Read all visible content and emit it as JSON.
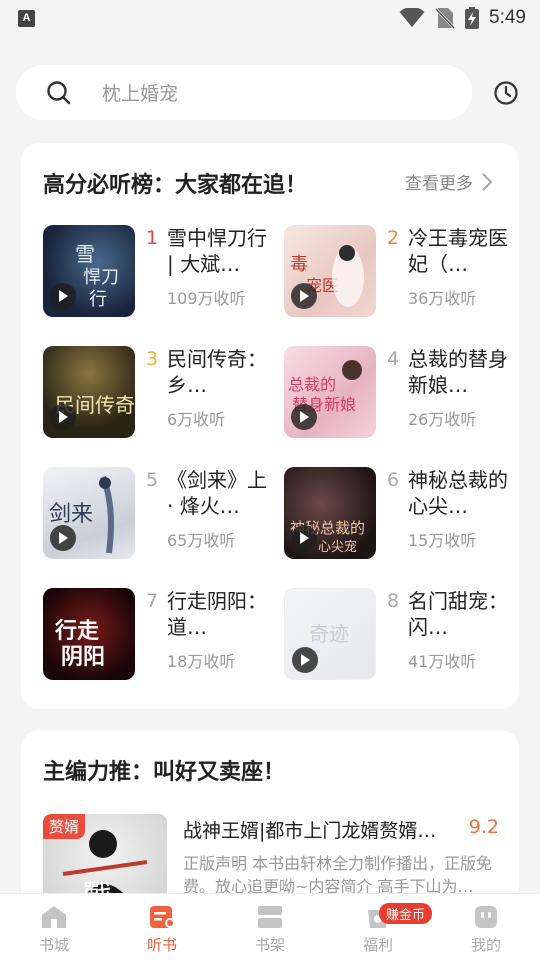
{
  "status_bar": {
    "time": "5:49",
    "left_icon_letter": "A"
  },
  "search": {
    "placeholder": "枕上婚宠"
  },
  "rank_section": {
    "title": "高分必听榜：大家都在追！",
    "more_label": "查看更多",
    "items": [
      {
        "rank": "1",
        "name": "雪中悍刀行 | 大斌…",
        "listens": "109万收听",
        "rank_color": "#e8443a"
      },
      {
        "rank": "2",
        "name": "冷王毒宠医妃（…",
        "listens": "36万收听",
        "rank_color": "#f0883d"
      },
      {
        "rank": "3",
        "name": "民间传奇：乡…",
        "listens": "6万收听",
        "rank_color": "#f2b13a"
      },
      {
        "rank": "4",
        "name": "总裁的替身新娘…",
        "listens": "26万收听",
        "rank_color": "#aaaaaa"
      },
      {
        "rank": "5",
        "name": "《剑来》上 · 烽火…",
        "listens": "65万收听",
        "rank_color": "#aaaaaa"
      },
      {
        "rank": "6",
        "name": "神秘总裁的心尖…",
        "listens": "15万收听",
        "rank_color": "#aaaaaa"
      },
      {
        "rank": "7",
        "name": "行走阴阳：道…",
        "listens": "18万收听",
        "rank_color": "#aaaaaa"
      },
      {
        "rank": "8",
        "name": "名门甜宠：闪…",
        "listens": "41万收听",
        "rank_color": "#aaaaaa"
      }
    ]
  },
  "editor_section": {
    "title": "主编力推：叫好又卖座！",
    "items": [
      {
        "tag": "赘婿",
        "name": "战神王婿|都市上门龙婿赘婿…",
        "score": "9.2",
        "desc": "正版声明 本书由轩林全力制作播出，正版免费。放心追更呦~内容简介 高手下山为…"
      }
    ]
  },
  "bottom_nav": {
    "items": [
      {
        "label": "书城",
        "icon": "home-icon",
        "active": false
      },
      {
        "label": "听书",
        "icon": "listen-icon",
        "active": true
      },
      {
        "label": "书架",
        "icon": "bookshelf-icon",
        "active": false
      },
      {
        "label": "福利",
        "icon": "gift-icon",
        "active": false
      },
      {
        "label": "我的",
        "icon": "profile-icon",
        "active": false
      }
    ],
    "welfare_badge": "赚金币"
  },
  "colors": {
    "accent": "#f0613d",
    "score": "#f0713d"
  }
}
